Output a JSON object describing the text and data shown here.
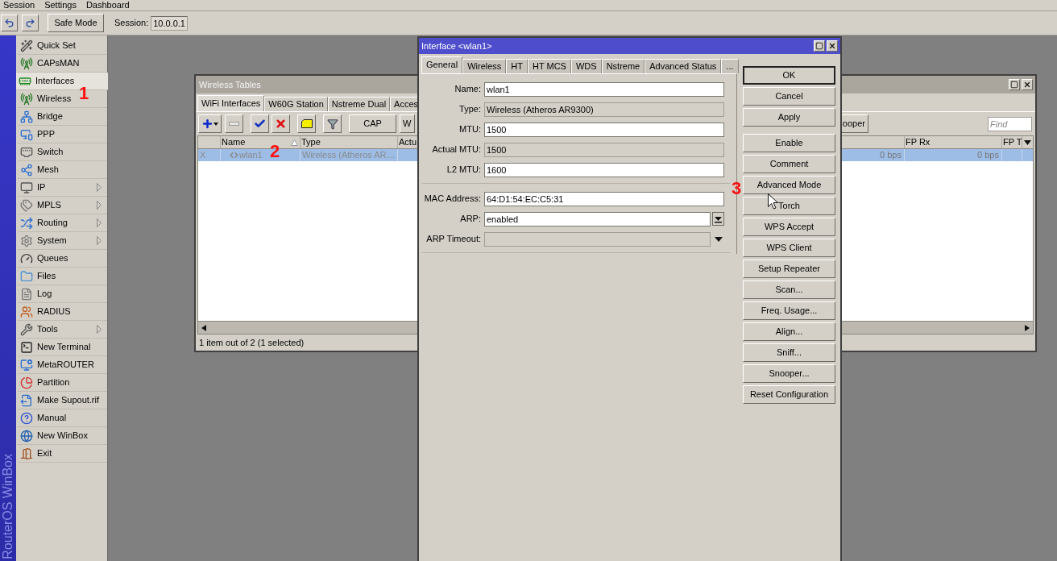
{
  "menu_bar": [
    "Session",
    "Settings",
    "Dashboard"
  ],
  "toolbar": {
    "safe_mode": "Safe Mode",
    "session_label": "Session:",
    "session_value": "10.0.0.1"
  },
  "side_banner": "RouterOS WinBox",
  "sidebar": {
    "items": [
      {
        "label": "Quick Set",
        "selected": false,
        "has_submenu": false
      },
      {
        "label": "CAPsMAN",
        "selected": false,
        "has_submenu": false
      },
      {
        "label": "Interfaces",
        "selected": true,
        "has_submenu": false
      },
      {
        "label": "Wireless",
        "selected": false,
        "has_submenu": false
      },
      {
        "label": "Bridge",
        "selected": false,
        "has_submenu": false
      },
      {
        "label": "PPP",
        "selected": false,
        "has_submenu": false
      },
      {
        "label": "Switch",
        "selected": false,
        "has_submenu": false
      },
      {
        "label": "Mesh",
        "selected": false,
        "has_submenu": false
      },
      {
        "label": "IP",
        "selected": false,
        "has_submenu": true
      },
      {
        "label": "MPLS",
        "selected": false,
        "has_submenu": true
      },
      {
        "label": "Routing",
        "selected": false,
        "has_submenu": true
      },
      {
        "label": "System",
        "selected": false,
        "has_submenu": true
      },
      {
        "label": "Queues",
        "selected": false,
        "has_submenu": false
      },
      {
        "label": "Files",
        "selected": false,
        "has_submenu": false
      },
      {
        "label": "Log",
        "selected": false,
        "has_submenu": false
      },
      {
        "label": "RADIUS",
        "selected": false,
        "has_submenu": false
      },
      {
        "label": "Tools",
        "selected": false,
        "has_submenu": true
      },
      {
        "label": "New Terminal",
        "selected": false,
        "has_submenu": false
      },
      {
        "label": "MetaROUTER",
        "selected": false,
        "has_submenu": false
      },
      {
        "label": "Partition",
        "selected": false,
        "has_submenu": false
      },
      {
        "label": "Make Supout.rif",
        "selected": false,
        "has_submenu": false
      },
      {
        "label": "Manual",
        "selected": false,
        "has_submenu": false
      },
      {
        "label": "New WinBox",
        "selected": false,
        "has_submenu": false
      },
      {
        "label": "Exit",
        "selected": false,
        "has_submenu": false
      }
    ]
  },
  "wireless_tables": {
    "title": "Wireless Tables",
    "tabs": [
      {
        "label": "WiFi Interfaces",
        "selected": true
      },
      {
        "label": "W60G Station",
        "selected": false
      },
      {
        "label": "Nstreme Dual",
        "selected": false
      },
      {
        "label": "Acces",
        "selected": false
      }
    ],
    "toolbar_buttons": [
      "CAP",
      "W"
    ],
    "toolbar_buttons_right": [
      "ooper"
    ],
    "find": {
      "placeholder": "Find"
    },
    "columns": [
      {
        "label": "Name",
        "sorted": true
      },
      {
        "label": "Type",
        "sorted": false
      },
      {
        "label": "Actu"
      },
      {
        "label": "FP Rx",
        "sorted": false
      },
      {
        "label": "FP T"
      }
    ],
    "rows": [
      {
        "flag": "X",
        "name": "wlan1",
        "type": "Wireless (Atheros AR…",
        "column_6": "0 bps",
        "fp_rx": "0 bps",
        "selected": true,
        "disabled": true
      }
    ],
    "status": "1 item out of 2 (1 selected)"
  },
  "interface_dialog": {
    "title": "Interface <wlan1>",
    "tabs": [
      {
        "label": "General",
        "selected": true
      },
      {
        "label": "Wireless",
        "selected": false
      },
      {
        "label": "HT",
        "selected": false
      },
      {
        "label": "HT MCS",
        "selected": false
      },
      {
        "label": "WDS",
        "selected": false
      },
      {
        "label": "Nstreme",
        "selected": false
      },
      {
        "label": "Advanced Status",
        "selected": false
      },
      {
        "label": "...",
        "selected": false
      }
    ],
    "field_groups": [
      [
        {
          "label": "Name:",
          "value": "wlan1",
          "readonly": false,
          "kind": "text"
        },
        {
          "label": "Type:",
          "value": "Wireless (Atheros AR9300)",
          "readonly": true,
          "kind": "text"
        },
        {
          "label": "MTU:",
          "value": "1500",
          "readonly": false,
          "kind": "text"
        },
        {
          "label": "Actual MTU:",
          "value": "1500",
          "readonly": true,
          "kind": "text"
        },
        {
          "label": "L2 MTU:",
          "value": "1600",
          "readonly": false,
          "kind": "text"
        }
      ],
      [
        {
          "label": "MAC Address:",
          "value": "64:D1:54:EC:C5:31",
          "readonly": false,
          "kind": "text"
        },
        {
          "label": "ARP:",
          "value": "enabled",
          "readonly": false,
          "kind": "select"
        },
        {
          "label": "ARP Timeout:",
          "readonly": true,
          "kind": "optional"
        }
      ]
    ],
    "button_groups": [
      [
        {
          "label": "OK",
          "default": true
        },
        {
          "label": "Cancel",
          "default": false
        },
        {
          "label": "Apply",
          "default": false
        }
      ],
      [
        {
          "label": "Enable",
          "default": false
        },
        {
          "label": "Comment",
          "default": false
        },
        {
          "label": "Advanced Mode",
          "default": false
        },
        {
          "label": "Torch",
          "default": false
        },
        {
          "label": "WPS Accept",
          "default": false
        },
        {
          "label": "WPS Client",
          "default": false
        },
        {
          "label": "Setup Repeater",
          "default": false
        },
        {
          "label": "Scan...",
          "default": false
        },
        {
          "label": "Freq. Usage...",
          "default": false
        },
        {
          "label": "Align...",
          "default": false
        },
        {
          "label": "Sniff...",
          "default": false
        },
        {
          "label": "Snooper...",
          "default": false
        },
        {
          "label": "Reset Configuration",
          "default": false
        }
      ]
    ]
  },
  "annotations": [
    {
      "text": "1"
    },
    {
      "text": "2"
    },
    {
      "text": "3"
    }
  ]
}
